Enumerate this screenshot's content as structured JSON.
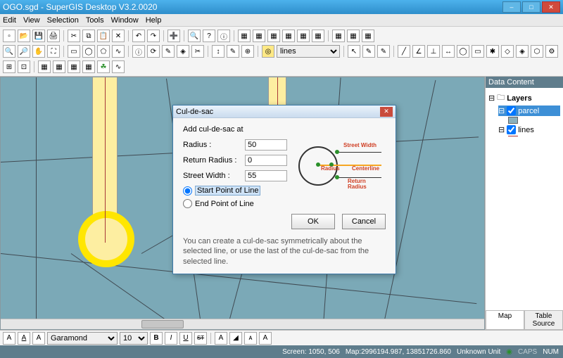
{
  "titlebar": {
    "title": "OGO.sgd - SuperGIS Desktop V3.2.0020"
  },
  "menu": {
    "items": [
      "Edit",
      "View",
      "Selection",
      "Tools",
      "Window",
      "Help"
    ]
  },
  "toolbar": {
    "layer_select": "lines",
    "font_select": "Garamond",
    "font_size": "10",
    "bold": "B",
    "italic": "I",
    "underline": "U",
    "strike": "ST"
  },
  "dialog": {
    "title": "Cul-de-sac",
    "heading": "Add cul-de-sac at",
    "radius_label": "Radius :",
    "radius_value": "50",
    "return_radius_label": "Return Radius :",
    "return_radius_value": "0",
    "street_width_label": "Street Width :",
    "street_width_value": "55",
    "radio_start": "Start Point of Line",
    "radio_end": "End Point of Line",
    "ok": "OK",
    "cancel": "Cancel",
    "hint": "You can create a cul-de-sac symmetrically about the selected line, or use the last of the cul-de-sac from the selected line.",
    "diag": {
      "street_width": "Street Width",
      "radius": "Radius",
      "centerline": "Centerline",
      "return_radius": "Return Radius"
    }
  },
  "sidepanel": {
    "title": "Data Content",
    "layers_label": "Layers",
    "items": [
      {
        "label": "parcel",
        "checked": true,
        "selected": true
      },
      {
        "label": "lines",
        "checked": true,
        "selected": false
      }
    ],
    "tabs": {
      "map": "Map",
      "table": "Table Source"
    }
  },
  "statusbar": {
    "screen": "Screen: 1050, 506",
    "map": "Map:2996194.987, 13851726.860",
    "unit": "Unknown Unit",
    "caps": "CAPS",
    "num": "NUM"
  }
}
